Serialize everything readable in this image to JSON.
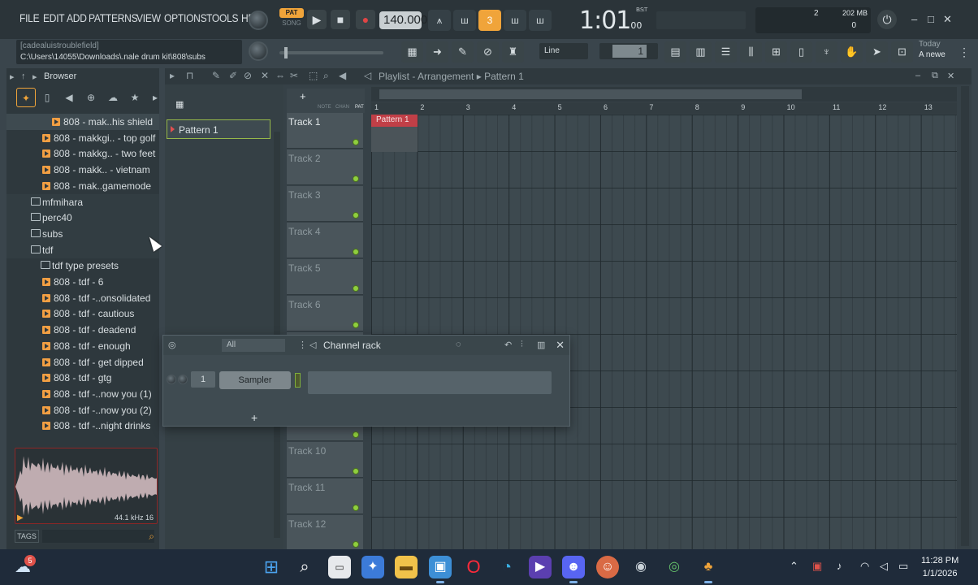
{
  "menu": [
    "FILE",
    "EDIT",
    "ADD",
    "PATTERNS",
    "VIEW",
    "OPTIONS",
    "TOOLS",
    "HELP"
  ],
  "transport": {
    "pat_label": "PAT",
    "song_label": "SONG",
    "bpm": "140.000",
    "time_main": "1:01",
    "time_sub": "00",
    "time_unit": "B:S:T",
    "cpu_count": "2",
    "memory": "202 MB",
    "poly": "0",
    "pattern_number": "1",
    "snap": "Line"
  },
  "hint": {
    "title": "[cadealuistroublefield]",
    "path": "C:\\Users\\14055\\Downloads\\.nale drum kit\\808\\subs"
  },
  "news": {
    "date": "Today",
    "text": "A newe"
  },
  "browser": {
    "title": "Browser",
    "items": [
      {
        "type": "file",
        "label": "808 - mak..his shield",
        "indent": 70,
        "selected": true
      },
      {
        "type": "file",
        "label": "808 - makkgi.. - top golf",
        "indent": 58
      },
      {
        "type": "file",
        "label": "808 - makkg.. - two feet",
        "indent": 58
      },
      {
        "type": "file",
        "label": "808 - makk.. - vietnam",
        "indent": 58
      },
      {
        "type": "file",
        "label": "808 - mak..gamemode",
        "indent": 58
      },
      {
        "type": "folder",
        "label": "mfmihara",
        "indent": 44
      },
      {
        "type": "folder",
        "label": "perc40",
        "indent": 44
      },
      {
        "type": "folder",
        "label": "subs",
        "indent": 44
      },
      {
        "type": "folder",
        "label": "tdf",
        "indent": 44
      },
      {
        "type": "folder",
        "label": "tdf type presets",
        "indent": 56
      },
      {
        "type": "file",
        "label": "808 - tdf - 6",
        "indent": 58
      },
      {
        "type": "file",
        "label": "808 - tdf -..onsolidated",
        "indent": 58
      },
      {
        "type": "file",
        "label": "808 - tdf - cautious",
        "indent": 58
      },
      {
        "type": "file",
        "label": "808 - tdf - deadend",
        "indent": 58
      },
      {
        "type": "file",
        "label": "808 - tdf - enough",
        "indent": 58
      },
      {
        "type": "file",
        "label": "808 - tdf - get dipped",
        "indent": 58
      },
      {
        "type": "file",
        "label": "808 - tdf - gtg",
        "indent": 58
      },
      {
        "type": "file",
        "label": "808 - tdf -..now you (1)",
        "indent": 58
      },
      {
        "type": "file",
        "label": "808 - tdf -..now you (2)",
        "indent": 58
      },
      {
        "type": "file",
        "label": "808 - tdf -..night drinks",
        "indent": 58
      }
    ],
    "sample_info": "44.1 kHz 16",
    "tags_label": "TAGS"
  },
  "playlist": {
    "title": "Playlist - Arrangement",
    "pattern_name": "Pattern 1",
    "pattern_list": [
      "Pattern 1"
    ],
    "ruler": [
      "1",
      "2",
      "3",
      "4",
      "5",
      "6",
      "7",
      "8",
      "9",
      "10",
      "11",
      "12",
      "13"
    ],
    "tracks": [
      "Track 1",
      "Track 2",
      "Track 3",
      "Track 4",
      "Track 5",
      "Track 6",
      "",
      "",
      "",
      "Track 10",
      "Track 11",
      "Track 12"
    ],
    "clip_label": "Pattern 1"
  },
  "channel_rack": {
    "title": "Channel rack",
    "filter": "All",
    "channels": [
      {
        "number": "1",
        "name": "Sampler"
      }
    ],
    "add_label": "+"
  },
  "taskbar": {
    "time": "11:28 PM",
    "date": "1/1/2026",
    "notifications": "5"
  },
  "colors": {
    "accent": "#f0a43a",
    "clip": "#c13f47",
    "led": "#8fce3e"
  }
}
